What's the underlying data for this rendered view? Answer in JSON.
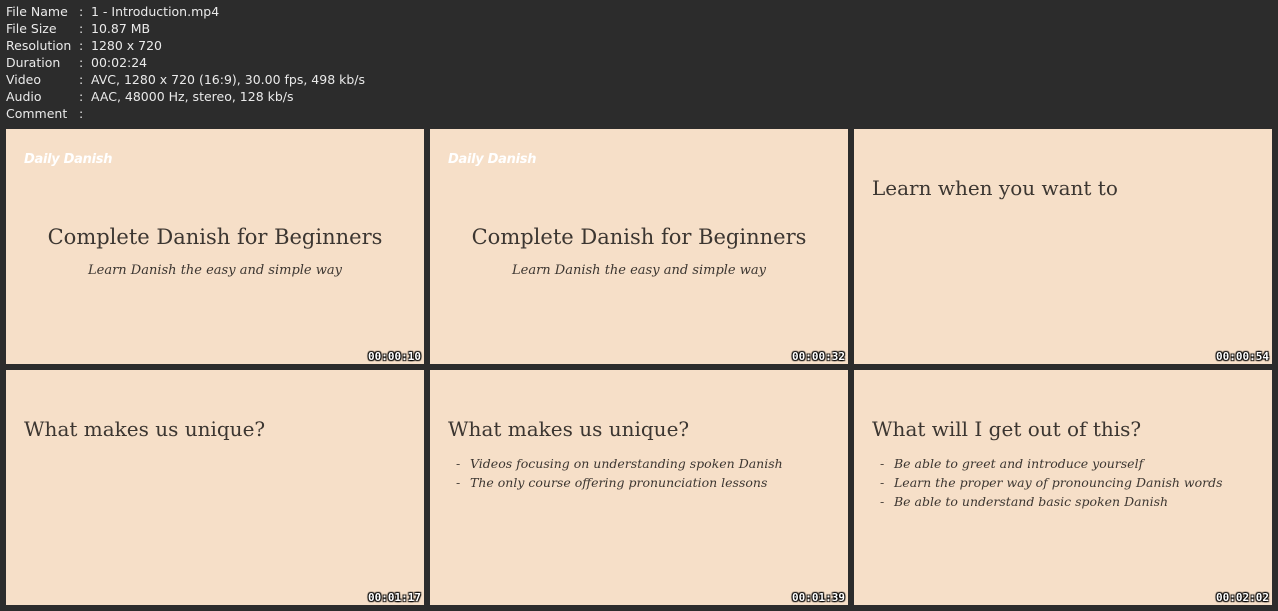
{
  "metadata": [
    {
      "key": "File Name",
      "value": "1 - Introduction.mp4"
    },
    {
      "key": "File Size",
      "value": "10.87 MB"
    },
    {
      "key": "Resolution",
      "value": "1280 x 720"
    },
    {
      "key": "Duration",
      "value": "00:02:24"
    },
    {
      "key": "Video",
      "value": "AVC, 1280 x 720 (16:9), 30.00 fps, 498 kb/s"
    },
    {
      "key": "Audio",
      "value": "AAC, 48000 Hz, stereo, 128 kb/s"
    },
    {
      "key": "Comment",
      "value": ""
    }
  ],
  "separator": ":",
  "colors": {
    "background": "#2c2c2c",
    "slide": "#f6dfc8",
    "slide_text": "#3c3631"
  },
  "thumbnails": [
    {
      "logo": "Daily Danish",
      "title": "Complete Danish for Beginners",
      "subtitle": "Learn Danish the easy and simple way",
      "timestamp": "00:00:10"
    },
    {
      "logo": "Daily Danish",
      "title": "Complete Danish for Beginners",
      "subtitle": "Learn Danish the easy and simple way",
      "timestamp": "00:00:32"
    },
    {
      "heading": "Learn when you want to",
      "timestamp": "00:00:54"
    },
    {
      "heading": "What makes us unique?",
      "timestamp": "00:01:17"
    },
    {
      "heading": "What makes us unique?",
      "bullets": [
        "Videos focusing on understanding spoken Danish",
        "The only course offering pronunciation lessons"
      ],
      "timestamp": "00:01:39"
    },
    {
      "heading": "What will I get out of this?",
      "bullets": [
        "Be able to greet and introduce yourself",
        "Learn the proper way of pronouncing Danish words",
        "Be able to understand basic spoken Danish"
      ],
      "timestamp": "00:02:02"
    }
  ]
}
